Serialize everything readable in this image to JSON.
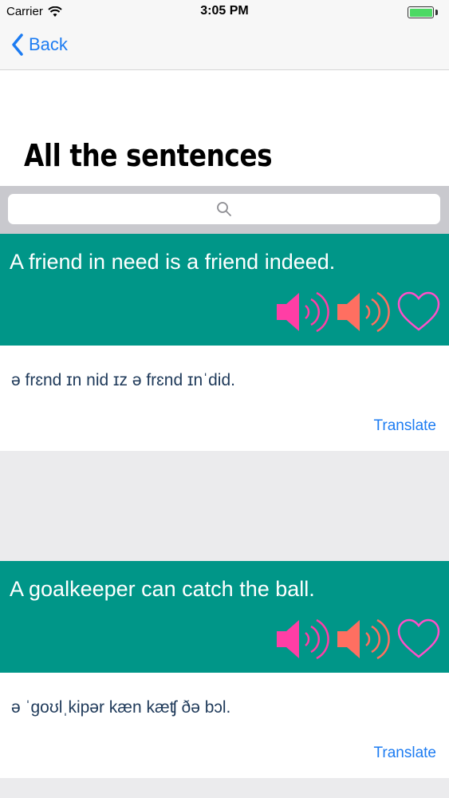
{
  "status": {
    "carrier": "Carrier",
    "time": "3:05 PM",
    "battery_color": "#4cd964"
  },
  "nav": {
    "back_label": "Back"
  },
  "header": {
    "title": "All the sentences"
  },
  "search": {
    "placeholder": ""
  },
  "colors": {
    "card": "#009688",
    "speaker_pink": "#ff3ea5",
    "speaker_coral": "#ff6f61",
    "heart": "#ff4fc8",
    "link": "#1d7cf2"
  },
  "sentences": [
    {
      "text": "A friend in need is a friend indeed.",
      "phonetic": "ə frɛnd ɪn nid ɪz ə frɛnd ɪnˈdid.",
      "translate_label": "Translate"
    },
    {
      "text": "A goalkeeper can catch the ball.",
      "phonetic": "ə ˈgoʊlˌkipər kæn kæʧ ðə bɔl.",
      "translate_label": "Translate"
    }
  ]
}
